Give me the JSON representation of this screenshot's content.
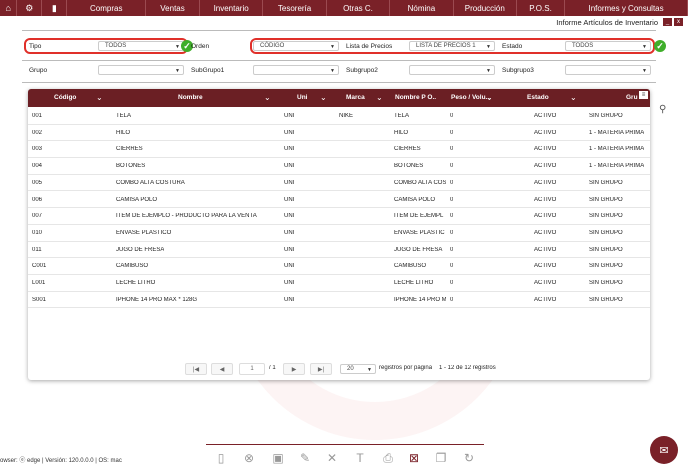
{
  "nav": {
    "items": [
      "Compras",
      "Ventas",
      "Inventario",
      "Tesorería",
      "Otras C.",
      "Nómina",
      "Producción",
      "P.O.S.",
      "Informes y Consultas"
    ]
  },
  "window": {
    "title": "Informe Artículos de Inventario",
    "minimize": "_",
    "close": "x"
  },
  "filters": {
    "tipo_label": "Tipo",
    "tipo_value": "TODOS",
    "orden_label": "Orden",
    "orden_value": "CÓDIGO",
    "lista_label": "Lista de Precios",
    "lista_value": "LISTA DE PRECIOS 1",
    "estado_label": "Estado",
    "estado_value": "TODOS",
    "grupo_label": "Grupo",
    "subgrupo1_label": "SubGrupo1",
    "subgrupo2_label": "Subgrupo2",
    "subgrupo3_label": "Subgrupo3"
  },
  "table": {
    "headers": [
      "Código",
      "Nombre",
      "Uni",
      "Marca",
      "Nombre P O..",
      "Peso / Volu...",
      "Estado",
      "Gru"
    ],
    "rows": [
      [
        "001",
        "TELA",
        "UNI",
        "NIKE",
        "TELA",
        "0",
        "ACTIVO",
        "SIN GRUPO"
      ],
      [
        "002",
        "HILO",
        "UNI",
        "",
        "HILO",
        "0",
        "ACTIVO",
        "1 - MATERIA PRIMA"
      ],
      [
        "003",
        "CIERRES",
        "UNI",
        "",
        "CIERRES",
        "0",
        "ACTIVO",
        "1 - MATERIA PRIMA"
      ],
      [
        "004",
        "BOTONES",
        "UNI",
        "",
        "BOTONES",
        "0",
        "ACTIVO",
        "1 - MATERIA PRIMA"
      ],
      [
        "005",
        "COMBO ALTA COSTURA",
        "UNI",
        "",
        "COMBO ALTA COS",
        "0",
        "ACTIVO",
        "SIN GRUPO"
      ],
      [
        "006",
        "CAMISA POLO",
        "UNI",
        "",
        "CAMISA POLO",
        "0",
        "ACTIVO",
        "SIN GRUPO"
      ],
      [
        "007",
        "ITEM DE EJEMPLO - PRODUCTO PARA LA VENTA",
        "UNI",
        "",
        "ITEM DE EJEMPL",
        "0",
        "ACTIVO",
        "SIN GRUPO"
      ],
      [
        "010",
        "ENVASE PLASTICO",
        "UNI",
        "",
        "ENVASE PLASTIC",
        "0",
        "ACTIVO",
        "SIN GRUPO"
      ],
      [
        "011",
        "JUGO DE FRESA",
        "UNI",
        "",
        "JUGO DE FRESA",
        "0",
        "ACTIVO",
        "SIN GRUPO"
      ],
      [
        "C001",
        "CAMIBUSO",
        "UNI",
        "",
        "CAMIBUSO",
        "0",
        "ACTIVO",
        "SIN GRUPO"
      ],
      [
        "L001",
        "LECHE LITRO",
        "UNI",
        "",
        "LECHE LITRO",
        "0",
        "ACTIVO",
        "SIN GRUPO"
      ],
      [
        "S001",
        "IPHONE 14 PRO MAX * 128G",
        "UNI",
        "",
        "IPHONE 14 PRO M",
        "0",
        "ACTIVO",
        "SIN GRUPO"
      ]
    ]
  },
  "pager": {
    "first": "|◀",
    "prev": "◀",
    "page": "1",
    "of": "/ 1",
    "next": "▶",
    "last": "▶|",
    "per_page": "20",
    "per_page_label": "registros por página",
    "summary": "1 - 12 de 12 registros"
  },
  "footer": "owser: ⓔ edge | Versión: 120.0.0.0 | OS: mac"
}
